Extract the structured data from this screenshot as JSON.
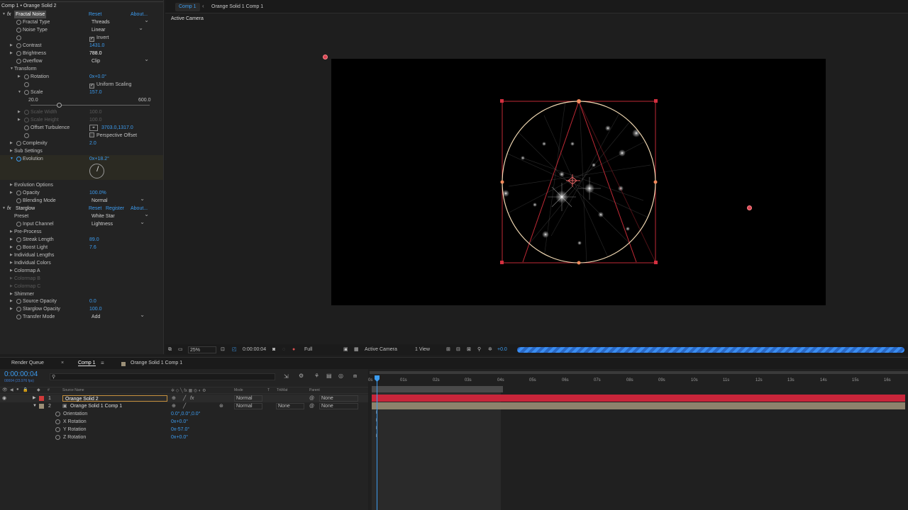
{
  "effect_controls": {
    "title": "Comp 1 • Orange Solid 2",
    "fractal_noise": {
      "name": "Fractal Noise",
      "reset": "Reset",
      "about": "About...",
      "props": [
        {
          "label": "Fractal Type",
          "value": "Threads"
        },
        {
          "label": "Noise Type",
          "value": "Linear"
        },
        {
          "label": "",
          "value": "Invert"
        },
        {
          "label": "Contrast",
          "value": "1431.0"
        },
        {
          "label": "Brightness",
          "value": "788.0"
        },
        {
          "label": "Overflow",
          "value": "Clip"
        },
        {
          "label": "Transform",
          "value": ""
        },
        {
          "label": "Rotation",
          "value": "0x+0.0°"
        },
        {
          "label": "",
          "value": "Uniform Scaling"
        },
        {
          "label": "Scale",
          "value": "157.0"
        },
        {
          "label": "Scale Width",
          "value": "100.0"
        },
        {
          "label": "Scale Height",
          "value": "100.0"
        },
        {
          "label": "Offset Turbulence",
          "value": "3703.0,1317.0"
        },
        {
          "label": "",
          "value": "Perspective Offset"
        },
        {
          "label": "Complexity",
          "value": "2.0"
        },
        {
          "label": "Sub Settings",
          "value": ""
        },
        {
          "label": "Evolution",
          "value": "0x+18.2°"
        },
        {
          "label": "Evolution Options",
          "value": ""
        },
        {
          "label": "Opacity",
          "value": "100.0%"
        },
        {
          "label": "Blending Mode",
          "value": "Normal"
        }
      ],
      "slider_min": "20.0",
      "slider_max": "600.0"
    },
    "starglow": {
      "name": "Starglow",
      "reset": "Reset",
      "register": "Register",
      "about": "About...",
      "props": [
        {
          "label": "Preset",
          "value": "White Star"
        },
        {
          "label": "Input Channel",
          "value": "Lightness"
        },
        {
          "label": "Pre-Process",
          "value": ""
        },
        {
          "label": "Streak Length",
          "value": "89.0"
        },
        {
          "label": "Boost Light",
          "value": "7.6"
        },
        {
          "label": "Individual Lengths",
          "value": ""
        },
        {
          "label": "Individual Colors",
          "value": ""
        },
        {
          "label": "Colormap A",
          "value": ""
        },
        {
          "label": "Colormap B",
          "value": ""
        },
        {
          "label": "Colormap C",
          "value": ""
        },
        {
          "label": "Shimmer",
          "value": ""
        },
        {
          "label": "Source Opacity",
          "value": "0.0"
        },
        {
          "label": "Starglow Opacity",
          "value": "100.0"
        },
        {
          "label": "Transfer Mode",
          "value": "Add"
        }
      ]
    }
  },
  "viewer": {
    "tabs": [
      "Comp 1",
      "Orange Solid 1 Comp 1"
    ],
    "camera_label": "Active Camera",
    "zoom": "25%",
    "timecode": "0:00:00:04",
    "resolution": "Full",
    "camera": "Active Camera",
    "views": "1 View",
    "exposure": "+0.0"
  },
  "timeline": {
    "tabs": [
      "Render Queue",
      "Comp 1",
      "Orange Solid 1 Comp 1"
    ],
    "timecode": "0:00:00:04",
    "frame_info": "00004 (23.976 fps)",
    "headers": {
      "num": "#",
      "source": "Source Name",
      "mode": "Mode",
      "t": "T",
      "trkmat": "TrkMat",
      "parent": "Parent"
    },
    "layers": [
      {
        "num": "1",
        "name": "Orange Solid 2",
        "mode": "Normal",
        "trkmat": "",
        "parent": "None",
        "color": "#d33a3a"
      },
      {
        "num": "2",
        "name": "Orange Solid 1 Comp 1",
        "mode": "Normal",
        "trkmat": "None",
        "parent": "None",
        "color": "#9b8f77"
      }
    ],
    "subprops": [
      {
        "label": "Orientation",
        "value": "0.0°,0.0°,0.0°"
      },
      {
        "label": "X Rotation",
        "value": "0x+0.0°"
      },
      {
        "label": "Y Rotation",
        "value": "0x-57.0°"
      },
      {
        "label": "Z Rotation",
        "value": "0x+0.0°"
      }
    ],
    "ruler": [
      "0s",
      "01s",
      "02s",
      "03s",
      "04s",
      "05s",
      "06s",
      "07s",
      "08s",
      "09s",
      "10s",
      "11s",
      "12s",
      "13s",
      "14s",
      "15s",
      "16s"
    ]
  }
}
